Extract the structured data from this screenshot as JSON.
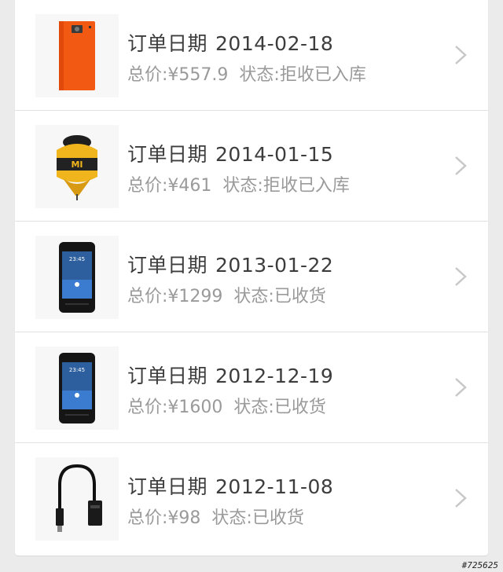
{
  "orders": [
    {
      "label": "订单日期",
      "date": "2014-02-18",
      "price": "总价:¥557.9",
      "status": "状态:拒收已入库",
      "image": "orange-phone-case"
    },
    {
      "label": "订单日期",
      "date": "2014-01-15",
      "price": "总价:¥461",
      "status": "状态:拒收已入库",
      "image": "mi-bunny-figure"
    },
    {
      "label": "订单日期",
      "date": "2013-01-22",
      "price": "总价:¥1299",
      "status": "状态:已收货",
      "image": "black-smartphone"
    },
    {
      "label": "订单日期",
      "date": "2012-12-19",
      "price": "总价:¥1600",
      "status": "状态:已收货",
      "image": "black-smartphone"
    },
    {
      "label": "订单日期",
      "date": "2012-11-08",
      "price": "总价:¥98",
      "status": "状态:已收货",
      "image": "usb-cable"
    }
  ],
  "watermark": "#725625",
  "colors": {
    "background": "#ebebeb",
    "card": "#ffffff",
    "primary_text": "#3d3d3d",
    "secondary_text": "#9a9a9a",
    "chevron": "#c8c8c8"
  }
}
